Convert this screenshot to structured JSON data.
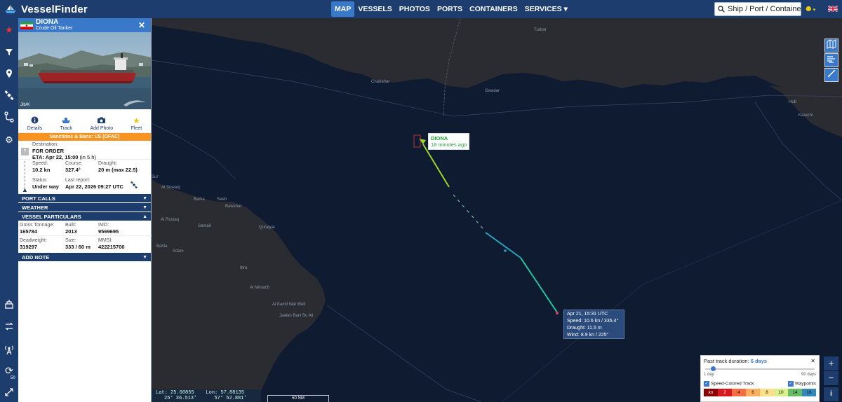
{
  "app": {
    "name": "VesselFinder"
  },
  "nav": {
    "items": [
      "MAP",
      "VESSELS",
      "PHOTOS",
      "PORTS",
      "CONTAINERS",
      "SERVICES ▾"
    ],
    "active_index": 0
  },
  "search": {
    "placeholder": "Ship / Port / Container"
  },
  "sidebar": {
    "icons": [
      "star-icon",
      "filter-icon",
      "pin-icon",
      "satellite-icon",
      "route-icon",
      "gear-icon",
      "port-icon",
      "switch-icon",
      "antenna-icon",
      "refresh-icon",
      "expand-icon"
    ],
    "refresh_badge": "50"
  },
  "vessel": {
    "name": "DIONA",
    "type": "Crude Oil Tanker",
    "photo_credit": "Jib/K",
    "flag_colors": {
      "green": "#239f40",
      "white": "#ffffff",
      "red": "#da0000"
    }
  },
  "actions": [
    {
      "label": "Details",
      "icon": "info-icon"
    },
    {
      "label": "Track",
      "icon": "ship-icon"
    },
    {
      "label": "Add Photo",
      "icon": "camera-icon"
    },
    {
      "label": "Fleet",
      "icon": "star-icon"
    }
  ],
  "sanctions": "Sanctions & Bans: US (OFAC)",
  "voyage": {
    "destination_label": "Destination:",
    "destination": "FOR ORDER",
    "eta_label": "ETA:",
    "eta": "Apr 22, 15:00",
    "eta_rel": "(in 5 h)",
    "speed_label": "Speed:",
    "speed": "10.2 kn",
    "course_label": "Course:",
    "course": "327.4°",
    "draught_label": "Draught:",
    "draught": "20 m (max 22.5)",
    "status_label": "Status:",
    "status": "Under way",
    "report_label": "Last report:",
    "report": "Apr 22, 2026 09:27 UTC"
  },
  "sections": {
    "port_calls": "PORT CALLS",
    "weather": "WEATHER",
    "particulars": "VESSEL PARTICULARS",
    "add_note": "ADD NOTE"
  },
  "particulars": {
    "gt_label": "Gross Tonnage:",
    "gt": "165784",
    "built_label": "Built:",
    "built": "2013",
    "imo_label": "IMO:",
    "imo": "9569695",
    "dwt_label": "Deadweight:",
    "dwt": "319297",
    "size_label": "Size:",
    "size": "333 / 60 m",
    "mmsi_label": "MMSI:",
    "mmsi": "422215700"
  },
  "map": {
    "places": [
      "Turbat",
      "Chabahar",
      "Gwadar",
      "Hub",
      "Karachi",
      "Sur",
      "Al Suwaiq",
      "Barka",
      "Seeb",
      "Bawshar",
      "Al Rustaq",
      "Samail",
      "Quraiyat",
      "Bahla",
      "Adam",
      "Ibra",
      "Al Mintarib",
      "Al Kamil Wal Wafi",
      "Jaalan Bani Bu Ali"
    ],
    "vessel_label_name": "DIONA",
    "vessel_label_time": "18 minutes ago",
    "tooltip": [
      "Apr 21, 15:31 UTC",
      "Speed: 10.6 kn / 335.4°",
      "Draught: 11.5 m",
      "Wind: 8.9 kn / 225°"
    ],
    "lat_label": "Lat:",
    "lat_dec": "25.60855",
    "lat_dms": "25° 36.513′",
    "lon_label": "Lon:",
    "lon_dec": "57.88135",
    "lon_dms": "57° 52.881′",
    "scale": "50 NM",
    "colors": {
      "sea": "#0f1b30",
      "land": "#2a2c31",
      "border": "#4b5566"
    }
  },
  "tools": [
    "map-layers-icon",
    "wind-icon",
    "measure-icon"
  ],
  "zoom": {
    "in": "+",
    "out": "−",
    "info": "i"
  },
  "track": {
    "title": "Past track duration:",
    "duration": "6 days",
    "min": "1 day",
    "max": "90 days",
    "value_days": 6,
    "speed_colored": "Speed-Colored Track",
    "waypoints": "Waypoints",
    "legend": [
      {
        "label": "kn",
        "color": "#8b0000"
      },
      {
        "label": "2",
        "color": "#d7191c"
      },
      {
        "label": "4",
        "color": "#f46d43"
      },
      {
        "label": "6",
        "color": "#fdae61"
      },
      {
        "label": "8",
        "color": "#fee08b"
      },
      {
        "label": "10",
        "color": "#d9ef8b"
      },
      {
        "label": "14",
        "color": "#66bd63"
      },
      {
        "label": "16",
        "color": "#3288bd"
      }
    ]
  }
}
